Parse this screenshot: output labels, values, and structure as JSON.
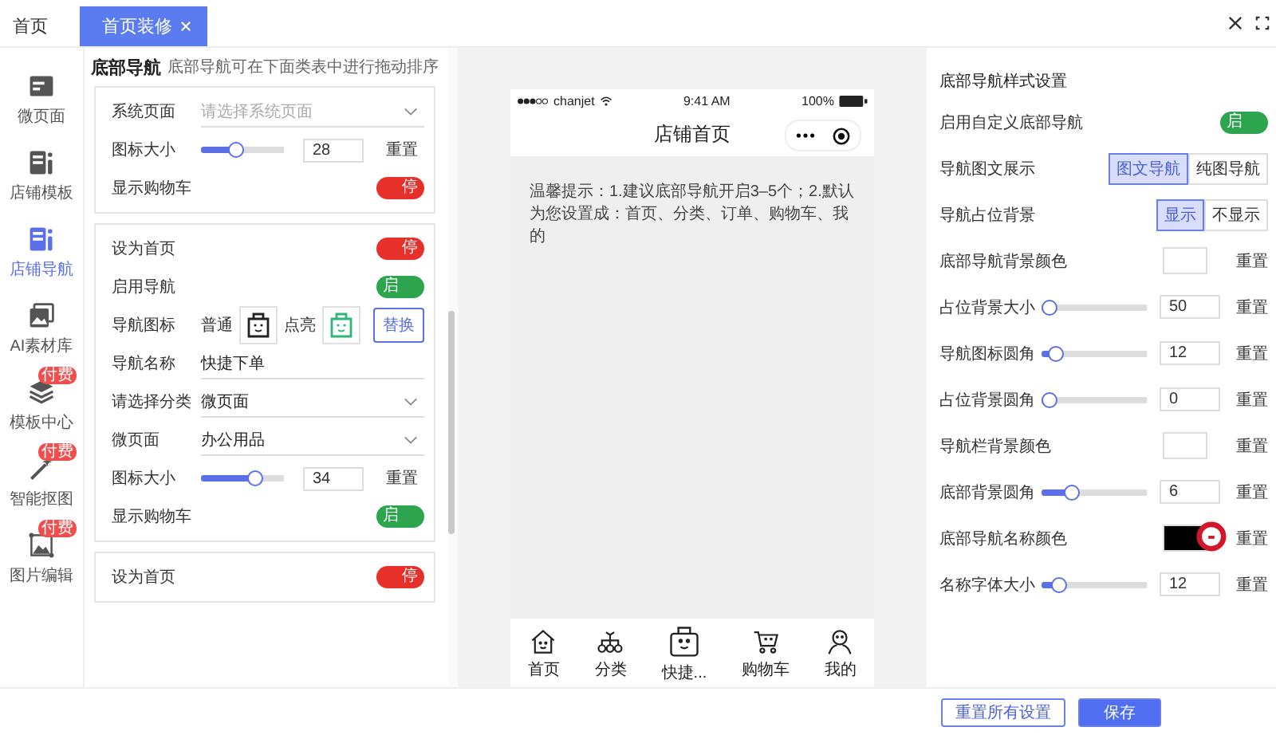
{
  "tabs": [
    {
      "label": "首页",
      "selected": false,
      "closable": false
    },
    {
      "label": "首页装修",
      "selected": true,
      "closable": true
    }
  ],
  "sidebar": {
    "items": [
      {
        "label": "微页面",
        "kind": "page",
        "selected": false
      },
      {
        "label": "店铺模板",
        "kind": "template",
        "selected": false
      },
      {
        "label": "店铺导航",
        "kind": "template",
        "selected": true
      },
      {
        "label": "AI素材库",
        "kind": "gallery",
        "selected": false
      },
      {
        "label": "模板中心",
        "kind": "layers",
        "selected": false,
        "badge": "付费"
      },
      {
        "label": "智能抠图",
        "kind": "wand",
        "selected": false,
        "badge": "付费"
      },
      {
        "label": "图片编辑",
        "kind": "image",
        "selected": false,
        "badge": "付费"
      }
    ]
  },
  "nav_editor": {
    "title": "底部导航",
    "hint": "底部导航可在下面类表中进行拖动排序",
    "cards": [
      {
        "rows": [
          {
            "kind": "select",
            "label": "系统页面",
            "placeholder": "请选择系统页面"
          },
          {
            "kind": "slider",
            "label": "图标大小",
            "level": 0.4,
            "value": "28",
            "action": "重置"
          },
          {
            "kind": "toggle",
            "label": "显示购物车",
            "on": false,
            "toggle_text": "停"
          }
        ]
      },
      {
        "rows": [
          {
            "kind": "toggle",
            "label": "设为首页",
            "on": false,
            "toggle_text": "停"
          },
          {
            "kind": "toggle",
            "label": "启用导航",
            "on": true,
            "toggle_text": "启"
          },
          {
            "kind": "icons",
            "label": "导航图标",
            "normal_label": "普通",
            "lit_label": "点亮",
            "button": "替换"
          },
          {
            "kind": "text",
            "label": "导航名称",
            "value": "快捷下单"
          },
          {
            "kind": "select",
            "label": "请选择分类",
            "value": "微页面"
          },
          {
            "kind": "select",
            "label": "微页面",
            "value": "办公用品"
          },
          {
            "kind": "slider",
            "label": "图标大小",
            "level": 0.7,
            "value": "34",
            "action": "重置"
          },
          {
            "kind": "toggle",
            "label": "显示购物车",
            "on": true,
            "toggle_text": "启"
          }
        ]
      },
      {
        "rows": [
          {
            "kind": "toggle",
            "label": "设为首页",
            "on": false,
            "toggle_text": "停"
          }
        ]
      }
    ]
  },
  "preview": {
    "status": {
      "carrier": "chanjet",
      "time": "9:41 AM",
      "battery": "100%"
    },
    "title": "店铺首页",
    "tip": "温馨提示：1.建议底部导航开启3–5个；2.默认为您设置成：首页、分类、订单、购物车、我的",
    "nav": [
      {
        "label": "首页",
        "kind": "house"
      },
      {
        "label": "分类",
        "kind": "category"
      },
      {
        "label": "快捷...",
        "kind": "bag"
      },
      {
        "label": "购物车",
        "kind": "cart"
      },
      {
        "label": "我的",
        "kind": "person"
      }
    ]
  },
  "style_panel": {
    "title": "底部导航样式设置",
    "rows": [
      {
        "kind": "toggle",
        "label": "启用自定义底部导航",
        "on": true,
        "toggle_text": "启"
      },
      {
        "kind": "segmented",
        "label": "导航图文展示",
        "options": [
          {
            "label": "图文导航",
            "selected": true
          },
          {
            "label": "纯图导航",
            "selected": false
          }
        ]
      },
      {
        "kind": "segmented",
        "label": "导航占位背景",
        "options": [
          {
            "label": "显示",
            "selected": true
          },
          {
            "label": "不显示",
            "selected": false
          }
        ]
      },
      {
        "kind": "color",
        "label": "底部导航背景颜色",
        "color": "#ffffff",
        "action": "重置"
      },
      {
        "kind": "slider",
        "label": "占位背景大小",
        "level": 0,
        "value": "50",
        "action": "重置"
      },
      {
        "kind": "slider",
        "label": "导航图标圆角",
        "level": 0.08,
        "value": "12",
        "action": "重置"
      },
      {
        "kind": "slider",
        "label": "占位背景圆角",
        "level": 0,
        "value": "0",
        "action": "重置"
      },
      {
        "kind": "color",
        "label": "导航栏背景颜色",
        "color": "#ffffff",
        "action": "重置"
      },
      {
        "kind": "slider",
        "label": "底部背景圆角",
        "level": 0.25,
        "value": "6",
        "action": "重置"
      },
      {
        "kind": "color",
        "label": "底部导航名称颜色",
        "color": "#000000",
        "action": "重置",
        "marker": true
      },
      {
        "kind": "slider",
        "label": "名称字体大小",
        "level": 0.1,
        "value": "12",
        "action": "重置"
      }
    ]
  },
  "footer": {
    "buttons": [
      {
        "label": "重置所有设置",
        "primary": false
      },
      {
        "label": "保存",
        "primary": true
      }
    ]
  }
}
